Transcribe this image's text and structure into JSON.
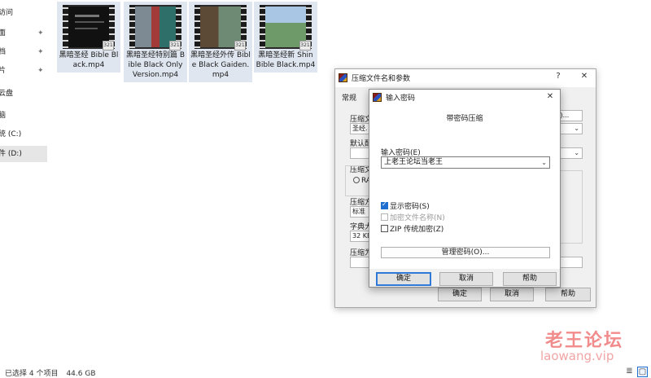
{
  "nav": {
    "items": [
      {
        "label": "访问",
        "pinned": false
      },
      {
        "label": "面",
        "pinned": true
      },
      {
        "label": "档",
        "pinned": true
      },
      {
        "label": "片",
        "pinned": true
      },
      {
        "label": "云盘",
        "pinned": false
      },
      {
        "label": "脑",
        "pinned": false
      },
      {
        "label": "统 (C:)",
        "pinned": false
      },
      {
        "label": "件 (D:)",
        "pinned": false
      }
    ],
    "pin_glyph": "📌"
  },
  "files": [
    {
      "name": "黑暗圣经 Bible Black.mp4"
    },
    {
      "name": "黑暗圣经特别篇 Bible Black Only Version.mp4"
    },
    {
      "name": "黑暗圣经外传 Bible Black Gaiden.mp4"
    },
    {
      "name": "黑暗圣经新 Shin Bible Black.mp4"
    }
  ],
  "status": {
    "selected": "已选择 4 个项目",
    "size": "44.6 GB"
  },
  "archive_dialog": {
    "title": "压缩文件名和参数",
    "help_glyph": "?",
    "close_glyph": "✕",
    "tab_general": "常规",
    "label_archive": "压缩文",
    "archive_value": "圣经.",
    "label_profile": "默认配",
    "label_format": "压缩文",
    "radio_rar": "RA",
    "label_method": "压缩方",
    "method_value": "标准",
    "label_dict": "字典大",
    "dict_value": "32 KB",
    "label_split": "压缩为",
    "browse_label": "B)...",
    "ok": "确定",
    "cancel": "取消",
    "help": "帮助"
  },
  "password_dialog": {
    "title": "输入密码",
    "close_glyph": "✕",
    "heading": "带密码压缩",
    "label_enter": "输入密码(E)",
    "password_value": "上老王论坛当老王",
    "chk_show": "显示密码(S)",
    "chk_show_checked": true,
    "chk_encrypt_names": "加密文件名称(N)",
    "chk_encrypt_names_checked": false,
    "chk_zip_legacy": "ZIP 传统加密(Z)",
    "chk_zip_legacy_checked": false,
    "manage": "管理密码(O)...",
    "ok": "确定",
    "cancel": "取消",
    "help": "帮助"
  },
  "watermark": {
    "cn": "老王论坛",
    "url": "laowang.vip"
  },
  "colors": {
    "accent": "#1f6fd1",
    "watermark": "#f28b8b"
  }
}
